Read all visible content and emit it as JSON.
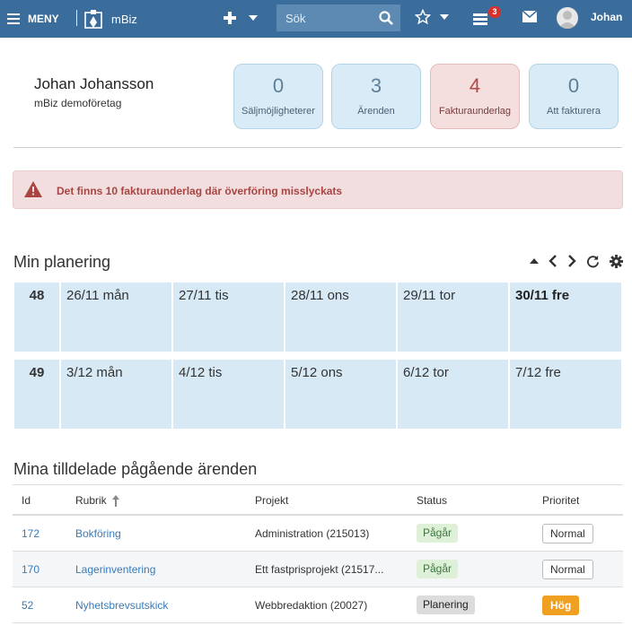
{
  "navbar": {
    "menu_label": "MENY",
    "app_name": "mBiz",
    "search_placeholder": "Sök",
    "tasks_badge": "3",
    "user_name": "Johan",
    "bg_color": "#3a6c9c"
  },
  "profile": {
    "name": "Johan Johansson",
    "company": "mBiz demoföretag"
  },
  "stats": [
    {
      "value": "0",
      "label": "Säljmöjligheterer"
    },
    {
      "value": "3",
      "label": "Ärenden"
    },
    {
      "value": "4",
      "label": "Fakturaunderlag"
    },
    {
      "value": "0",
      "label": "Att fakturera"
    }
  ],
  "alert": {
    "text": "Det finns 10 fakturaunderlag där överföring misslyckats",
    "color": "#a94442"
  },
  "planning": {
    "title": "Min planering",
    "weeks": [
      {
        "week": "48",
        "days": [
          "26/11 mån",
          "27/11 tis",
          "28/11 ons",
          "29/11 tor",
          "30/11 fre"
        ]
      },
      {
        "week": "49",
        "days": [
          "3/12 mån",
          "4/12 tis",
          "5/12 ons",
          "6/12 tor",
          "7/12 fre"
        ]
      }
    ]
  },
  "cases": {
    "title": "Mina tilldelade pågående ärenden",
    "columns": {
      "id": "Id",
      "rubrik": "Rubrik",
      "projekt": "Projekt",
      "status": "Status",
      "prioritet": "Prioritet"
    },
    "rows": [
      {
        "id": "172",
        "rubrik": "Bokföring",
        "projekt": "Administration (215013)",
        "status": "Pågår",
        "prioritet": "Normal"
      },
      {
        "id": "170",
        "rubrik": "Lagerinventering",
        "projekt": "Ett fastprisprojekt (21517...",
        "status": "Pågår",
        "prioritet": "Normal"
      },
      {
        "id": "52",
        "rubrik": "Nyhetsbrevsutskick",
        "projekt": "Webbredaktion (20027)",
        "status": "Planering",
        "prioritet": "Hög"
      }
    ]
  }
}
